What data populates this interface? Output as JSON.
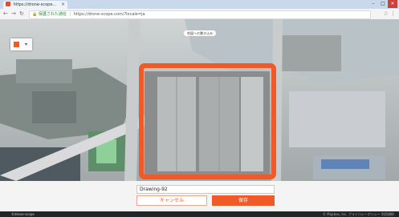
{
  "browser": {
    "tab_title": "https://drone-scope…",
    "tab_close": "×",
    "address": {
      "secure_label": "保護された通信",
      "url": "https://drone-scope.com/?locale=ja"
    },
    "controls": {
      "minimize": "–",
      "maximize": "□",
      "close": "×"
    }
  },
  "map": {
    "top_label": "地図への書き込み",
    "drawing_color": "#f05a28"
  },
  "panel": {
    "drawing_name": "Drawing-92",
    "cancel_label": "キャンセル",
    "save_label": "保存"
  },
  "footer": {
    "left_text": "©drone-scope",
    "right_text": "© Mapbox, Inc.  プライバシーポリシー  利用規約"
  }
}
